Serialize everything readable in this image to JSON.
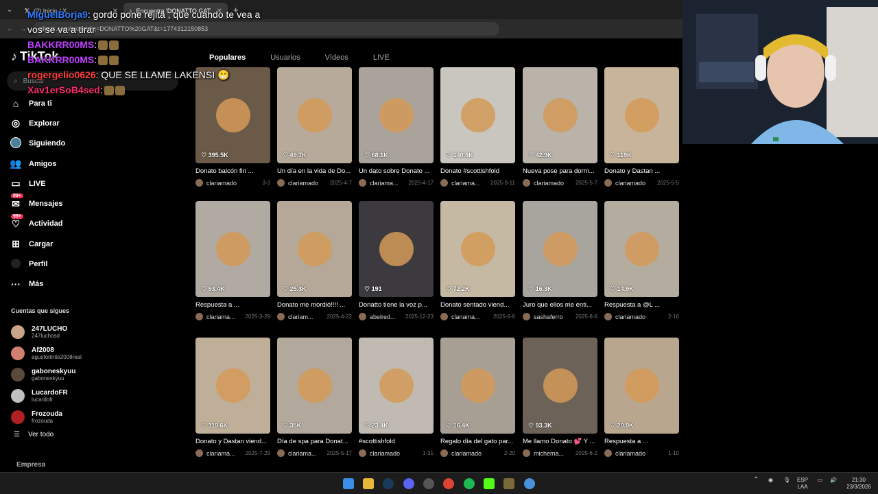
{
  "browser": {
    "tabs": [
      {
        "label": "(2) Inicio / X",
        "icon": "x-logo-icon"
      },
      {
        "label": "Encuentra 'DONATTO GAT",
        "icon": "tiktok-icon",
        "active": true
      }
    ],
    "new_tab": "+",
    "url": "tiktok.com/search?q=DONATTO%20GAT&t=1774312150853"
  },
  "sidebar": {
    "logo": "TikTok",
    "search_placeholder": "Buscar",
    "nav": [
      {
        "label": "Para ti",
        "icon": "home-icon"
      },
      {
        "label": "Explorar",
        "icon": "compass-icon"
      },
      {
        "label": "Siguiendo",
        "icon": "avatar-icon"
      },
      {
        "label": "Amigos",
        "icon": "friends-icon"
      },
      {
        "label": "LIVE",
        "icon": "live-icon"
      },
      {
        "label": "Mensajes",
        "icon": "message-icon",
        "badge": "99+"
      },
      {
        "label": "Actividad",
        "icon": "activity-icon",
        "badge": "99+"
      },
      {
        "label": "Cargar",
        "icon": "upload-icon"
      },
      {
        "label": "Perfil",
        "icon": "profile-icon"
      },
      {
        "label": "Más",
        "icon": "more-icon"
      }
    ],
    "following_title": "Cuentas que sigues",
    "following": [
      {
        "name": "247LUCHO",
        "handle": "247luchosd",
        "color": "#c9a38a"
      },
      {
        "name": "Af2008",
        "handle": "agusfortnite2008real",
        "color": "#d08070"
      },
      {
        "name": "gaboneskyuu",
        "handle": "gaboneskyuu",
        "color": "#5a4a3a"
      },
      {
        "name": "LucardoFR",
        "handle": "lucardofr",
        "color": "#c0c0c0"
      },
      {
        "name": "Frozouda",
        "handle": "frozouda",
        "color": "#b02020"
      }
    ],
    "see_all": "Ver todo",
    "company": "Empresa"
  },
  "search_tabs": [
    "Populares",
    "Usuarios",
    "Vídeos",
    "LIVE"
  ],
  "videos": [
    {
      "views": "395.5K",
      "caption": "Donato balcón fin ...",
      "author": "clariamado",
      "date": "3-3",
      "color": "#6b5a48"
    },
    {
      "views": "49.7K",
      "caption": "Un día en la vida de Do...",
      "author": "clariamado",
      "date": "2025-4-7",
      "color": "#b7aa9a"
    },
    {
      "views": "68.1K",
      "caption": "Un dato sobre Donato ...",
      "author": "clariama...",
      "date": "2025-4-17",
      "color": "#a9a39b"
    },
    {
      "views": "140.6K",
      "caption": "Donato #scottishfold",
      "author": "clariama...",
      "date": "2025-9-11",
      "color": "#c9c6c0"
    },
    {
      "views": "42.9K",
      "caption": "Nueva pose para dorm...",
      "author": "clariamado",
      "date": "2025-5-7",
      "color": "#b9b3aa"
    },
    {
      "views": "119K",
      "caption": "Donato y Dastan ...",
      "author": "clariamado",
      "date": "2025-5-5",
      "color": "#c8b49a"
    },
    {
      "views": "93.4K",
      "caption": "Respuesta a ...",
      "author": "clariama...",
      "date": "2025-3-29",
      "color": "#b0aaa2"
    },
    {
      "views": "25.3K",
      "caption": "Donato me mordió!!!! ...",
      "author": "clariam...",
      "date": "2025-4-22",
      "color": "#b6a898"
    },
    {
      "views": "191",
      "caption": "Donatto tiene la voz p...",
      "author": "abelred...",
      "date": "2025-12-23",
      "color": "#3c3a3e"
    },
    {
      "views": "72.2K",
      "caption": "Donato sentado viend...",
      "author": "clariama...",
      "date": "2025-6-6",
      "color": "#c6b9a4"
    },
    {
      "views": "16.3K",
      "caption": "Juro que ellos me enti...",
      "author": "sashaferro",
      "date": "2025-8-6",
      "color": "#a8a49e"
    },
    {
      "views": "14.9K",
      "caption": "Respuesta a @L ...",
      "author": "clariamado",
      "date": "2-16",
      "color": "#b4ac9f"
    },
    {
      "views": "119.6K",
      "caption": "Donato y Dastan viend...",
      "author": "clariama...",
      "date": "2025-7-29",
      "color": "#bfae98"
    },
    {
      "views": "35K",
      "caption": "Día de spa para Donat...",
      "author": "clariama...",
      "date": "2025-5-17",
      "color": "#b3a89c"
    },
    {
      "views": "23.4K",
      "caption": "#scottishfold",
      "author": "clariamado",
      "date": "1-31",
      "color": "#c0bab2"
    },
    {
      "views": "16.4K",
      "caption": "Regalo día del gato par...",
      "author": "clariamado",
      "date": "2-20",
      "color": "#a79f94"
    },
    {
      "views": "93.3K",
      "caption": "Me llamo Donato 💕 Y ...",
      "author": "michema...",
      "date": "2025-6-2",
      "color": "#6d6258"
    },
    {
      "views": "20.9K",
      "caption": "Respuesta a ...",
      "author": "clariamado",
      "date": "1-10",
      "color": "#b9a68e"
    }
  ],
  "chat": [
    {
      "user": "MiguelBorja9",
      "color": "#2f7bff",
      "text": ": gordo pone rejita , que cuando te vea a vos se va a tirar"
    },
    {
      "user": "BAKKRR00MS",
      "color": "#c040ff",
      "text": ":",
      "emotes": 2
    },
    {
      "user": "BAKKRR00MS",
      "color": "#c040ff",
      "text": ":",
      "emotes": 2
    },
    {
      "user": "rogergelio0626",
      "color": "#ff3b3b",
      "text": ": QUE SE LLAME LAKENSI 😁"
    },
    {
      "user": "Xav1erSoB4sed",
      "color": "#ff2a6a",
      "text": ":",
      "emotes": 2
    }
  ],
  "tray": {
    "lang_1": "ESP",
    "lang_2": "LAA",
    "time": "21:30",
    "date": "23/3/2026"
  }
}
